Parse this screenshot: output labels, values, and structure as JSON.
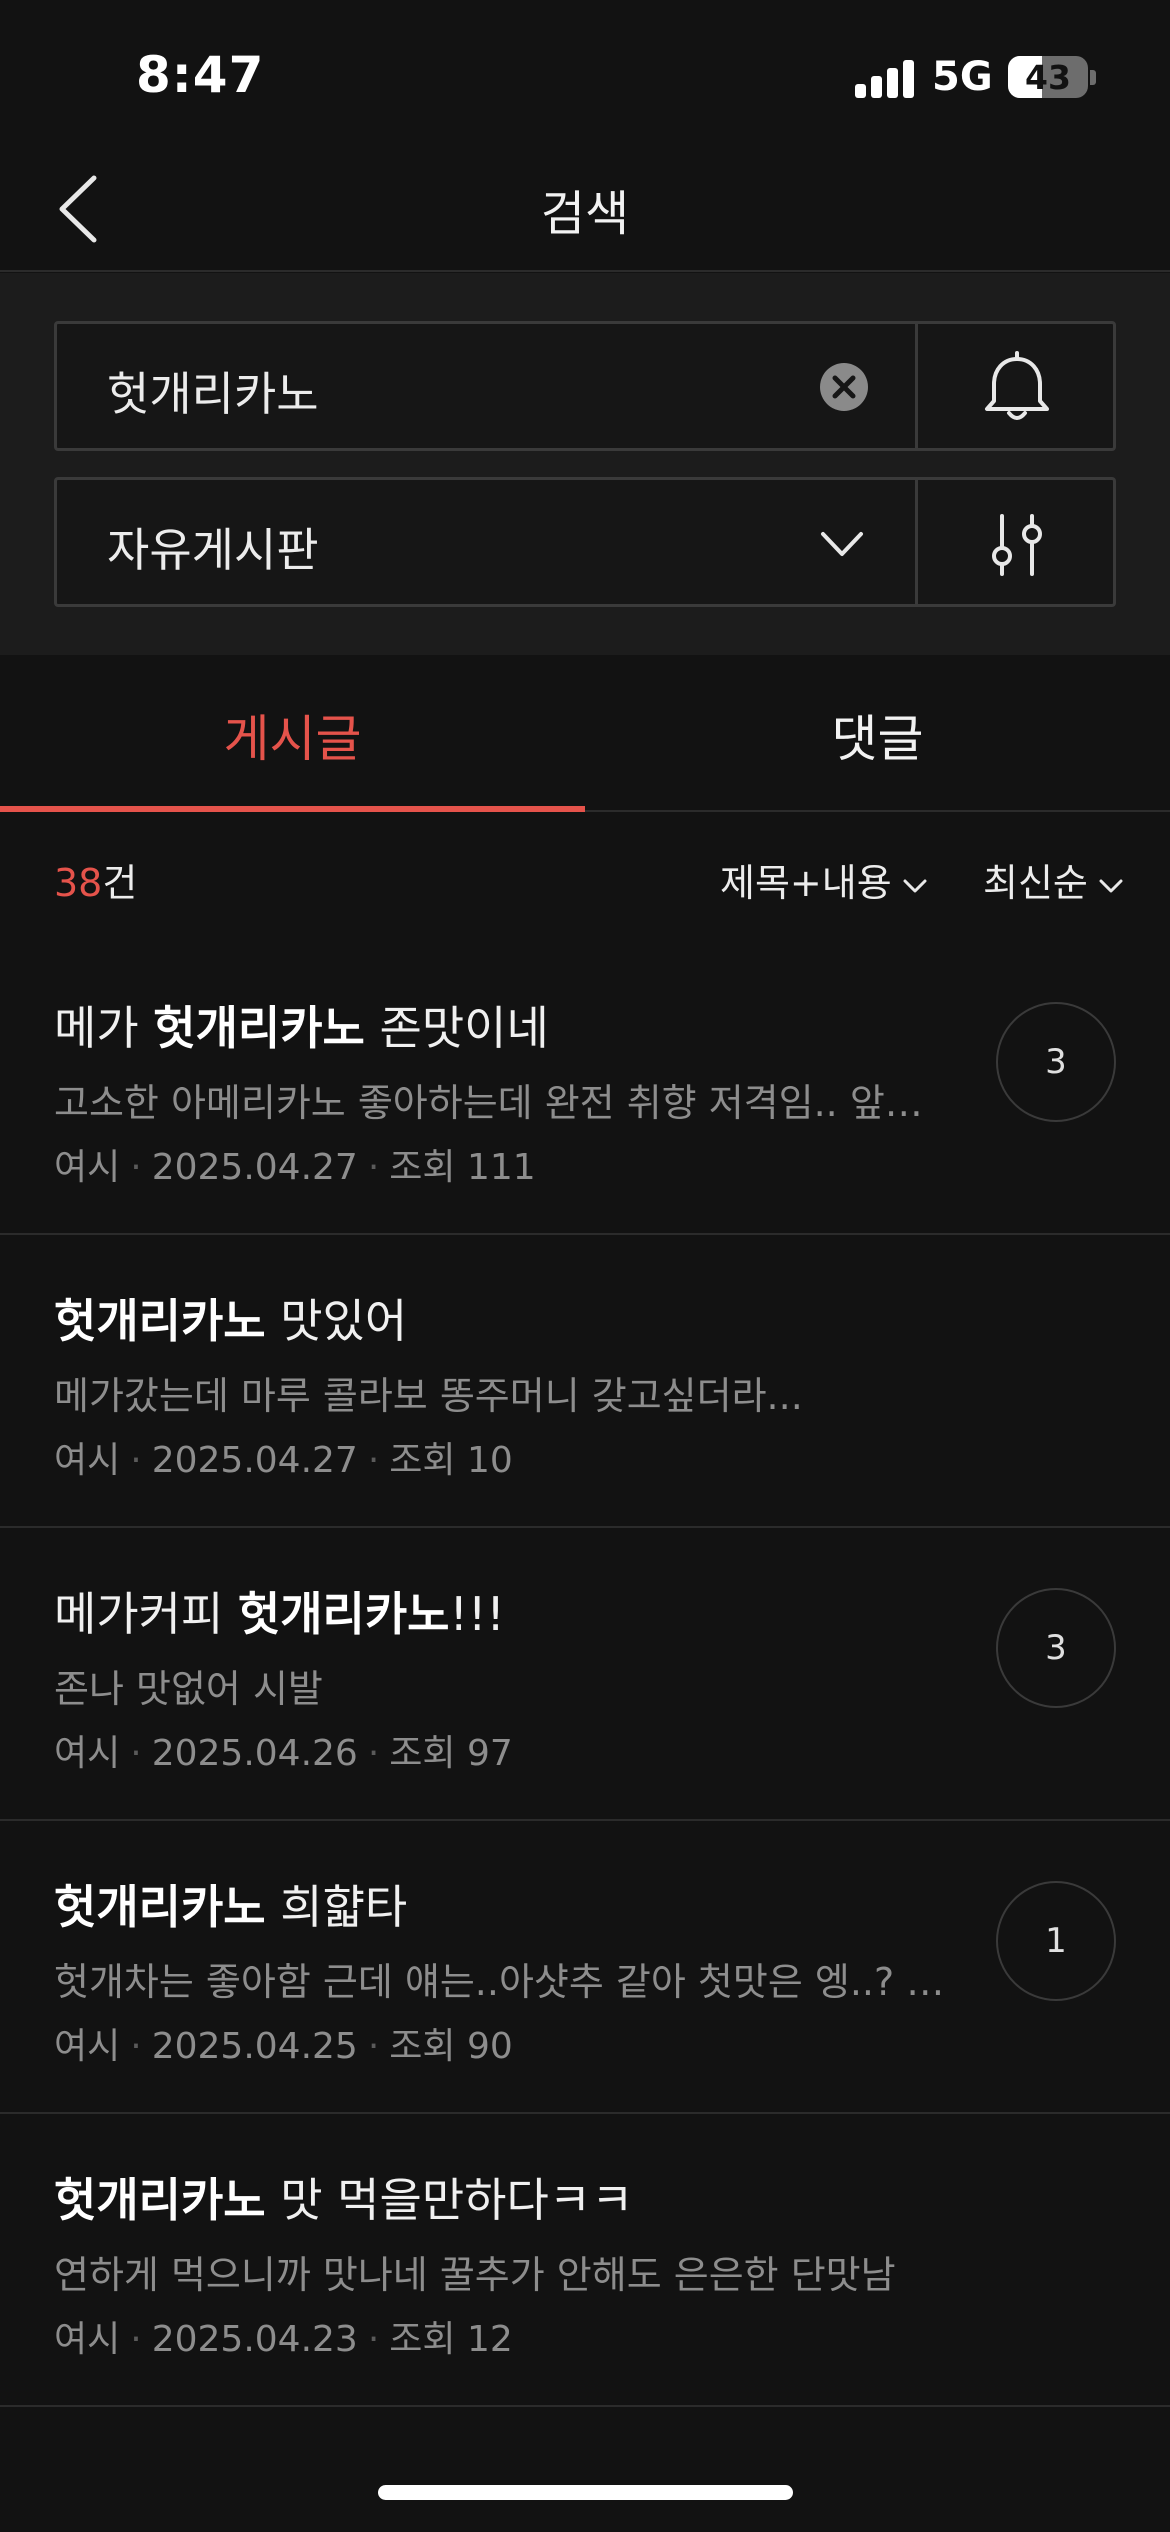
{
  "status_bar": {
    "time": "8:47",
    "network": "5G",
    "battery": "43",
    "battery_level": 0.43
  },
  "header": {
    "title": "검색"
  },
  "search": {
    "query": "헛개리카노",
    "board": "자유게시판"
  },
  "tabs": [
    {
      "label": "게시글",
      "active": true
    },
    {
      "label": "댓글",
      "active": false
    }
  ],
  "results": {
    "count": "38",
    "unit": "건",
    "scope_label": "제목+내용",
    "sort_label": "최신순"
  },
  "posts": [
    {
      "title_pre": "메가 ",
      "title_keyword": "헛개리카노",
      "title_post": " 존맛이네",
      "preview": "고소한 아메리카노 좋아하는데 완전 취향 저격임.. 앞으로...",
      "author": "여시",
      "date": "2025.04.27",
      "views": "조회 111",
      "comments": "3"
    },
    {
      "title_pre": "",
      "title_keyword": "헛개리카노",
      "title_post": " 맛있어",
      "preview": "메가갔는데 마루 콜라보 똥주머니 갖고싶더라...",
      "author": "여시",
      "date": "2025.04.27",
      "views": "조회 10",
      "comments": ""
    },
    {
      "title_pre": "메가커피 ",
      "title_keyword": "헛개리카노",
      "title_post": "!!!",
      "preview": "존나 맛없어 시발",
      "author": "여시",
      "date": "2025.04.26",
      "views": "조회 97",
      "comments": "3"
    },
    {
      "title_pre": "",
      "title_keyword": "헛개리카노",
      "title_post": " 희햛타",
      "preview": "헛개차는 좋아함 근데 얘는..아샷추 같아 첫맛은 엥..? 희…",
      "author": "여시",
      "date": "2025.04.25",
      "views": "조회 90",
      "comments": "1"
    },
    {
      "title_pre": "",
      "title_keyword": "헛개리카노",
      "title_post": " 맛 먹을만하다ㅋㅋ",
      "preview": "연하게 먹으니까 맛나네 꿀추가 안해도 은은한 단맛남",
      "author": "여시",
      "date": "2025.04.23",
      "views": "조회 12",
      "comments": ""
    }
  ],
  "colors": {
    "accent": "#e5534b",
    "background": "#121212",
    "panel": "#1c1c1c"
  }
}
